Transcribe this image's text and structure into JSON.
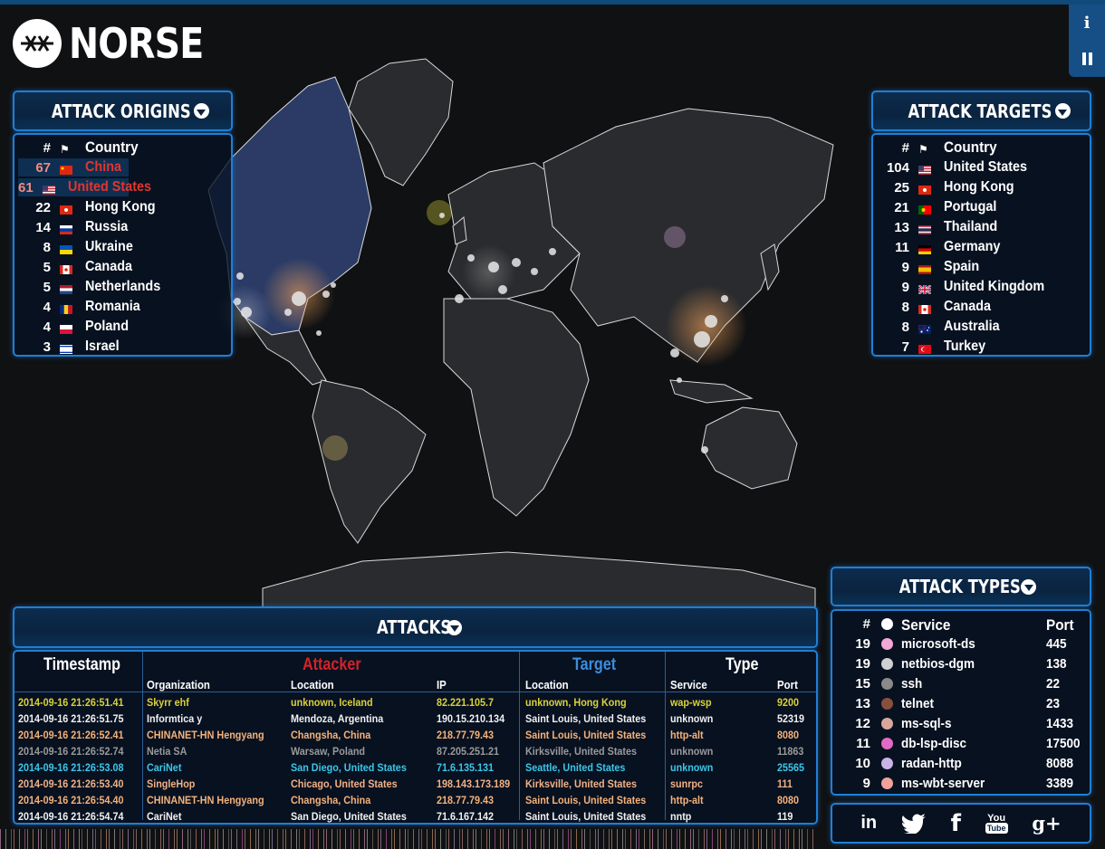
{
  "brand": {
    "name": "NORSE"
  },
  "controls": {
    "info_label": "i",
    "pause_label": "II"
  },
  "origins": {
    "title": "ATTACK ORIGINS",
    "headers": {
      "num": "#",
      "flag": "⚑",
      "country": "Country"
    },
    "rows": [
      {
        "count": "67",
        "country": "China",
        "flag": "china",
        "highlight": true
      },
      {
        "count": "61",
        "country": "United States",
        "flag": "usa",
        "highlight": true
      },
      {
        "count": "22",
        "country": "Hong Kong",
        "flag": "hongkong"
      },
      {
        "count": "14",
        "country": "Russia",
        "flag": "russia"
      },
      {
        "count": "8",
        "country": "Ukraine",
        "flag": "ukraine"
      },
      {
        "count": "5",
        "country": "Canada",
        "flag": "canada"
      },
      {
        "count": "5",
        "country": "Netherlands",
        "flag": "netherlands"
      },
      {
        "count": "4",
        "country": "Romania",
        "flag": "romania"
      },
      {
        "count": "4",
        "country": "Poland",
        "flag": "poland"
      },
      {
        "count": "3",
        "country": "Israel",
        "flag": "israel"
      }
    ]
  },
  "targets": {
    "title": "ATTACK TARGETS",
    "headers": {
      "num": "#",
      "flag": "⚑",
      "country": "Country"
    },
    "rows": [
      {
        "count": "104",
        "country": "United States",
        "flag": "usa"
      },
      {
        "count": "25",
        "country": "Hong Kong",
        "flag": "hongkong"
      },
      {
        "count": "21",
        "country": "Portugal",
        "flag": "portugal"
      },
      {
        "count": "13",
        "country": "Thailand",
        "flag": "thailand"
      },
      {
        "count": "11",
        "country": "Germany",
        "flag": "germany"
      },
      {
        "count": "9",
        "country": "Spain",
        "flag": "spain"
      },
      {
        "count": "9",
        "country": "United Kingdom",
        "flag": "uk"
      },
      {
        "count": "8",
        "country": "Canada",
        "flag": "canada"
      },
      {
        "count": "8",
        "country": "Australia",
        "flag": "australia"
      },
      {
        "count": "7",
        "country": "Turkey",
        "flag": "turkey"
      }
    ]
  },
  "types": {
    "title": "ATTACK TYPES",
    "headers": {
      "num": "#",
      "service": "Service",
      "port": "Port"
    },
    "rows": [
      {
        "count": "19",
        "service": "microsoft-ds",
        "port": "445",
        "color": "#f2a8d6"
      },
      {
        "count": "19",
        "service": "netbios-dgm",
        "port": "138",
        "color": "#d0d0d0"
      },
      {
        "count": "15",
        "service": "ssh",
        "port": "22",
        "color": "#8a8a8a"
      },
      {
        "count": "13",
        "service": "telnet",
        "port": "23",
        "color": "#8a4f3c"
      },
      {
        "count": "12",
        "service": "ms-sql-s",
        "port": "1433",
        "color": "#d8a89a"
      },
      {
        "count": "11",
        "service": "db-lsp-disc",
        "port": "17500",
        "color": "#e06bc4"
      },
      {
        "count": "10",
        "service": "radan-http",
        "port": "8088",
        "color": "#c9b3e6"
      },
      {
        "count": "9",
        "service": "ms-wbt-server",
        "port": "3389",
        "color": "#f0a39b"
      }
    ]
  },
  "attacks": {
    "title": "ATTACKS",
    "headers": {
      "timestamp": "Timestamp",
      "attacker": "Attacker",
      "target": "Target",
      "type": "Type",
      "organization": "Organization",
      "location": "Location",
      "ip": "IP",
      "target_location": "Location",
      "service": "Service",
      "port": "Port"
    },
    "rows": [
      {
        "ts": "2014-09-16 21:26:51.41",
        "org": "Skyrr ehf",
        "loc": "unknown, Iceland",
        "ip": "82.221.105.7",
        "tloc": "unknown, Hong Kong",
        "svc": "wap-wsp",
        "port": "9200",
        "color": "#d9d23a"
      },
      {
        "ts": "2014-09-16 21:26:51.75",
        "org": "Informtica y",
        "loc": "Mendoza, Argentina",
        "ip": "190.15.210.134",
        "tloc": "Saint Louis, United States",
        "svc": "unknown",
        "port": "52319",
        "color": "#f1f1f1"
      },
      {
        "ts": "2014-09-16 21:26:52.41",
        "org": "CHINANET-HN Hengyang",
        "loc": "Changsha, China",
        "ip": "218.77.79.43",
        "tloc": "Saint Louis, United States",
        "svc": "http-alt",
        "port": "8080",
        "color": "#f5b27a"
      },
      {
        "ts": "2014-09-16 21:26:52.74",
        "org": "Netia SA",
        "loc": "Warsaw, Poland",
        "ip": "87.205.251.21",
        "tloc": "Kirksville, United States",
        "svc": "unknown",
        "port": "11863",
        "color": "#9a9a9a"
      },
      {
        "ts": "2014-09-16 21:26:53.08",
        "org": "CariNet",
        "loc": "San Diego, United States",
        "ip": "71.6.135.131",
        "tloc": "Seattle, United States",
        "svc": "unknown",
        "port": "25565",
        "color": "#3cc6e8"
      },
      {
        "ts": "2014-09-16 21:26:53.40",
        "org": "SingleHop",
        "loc": "Chicago, United States",
        "ip": "198.143.173.189",
        "tloc": "Kirksville, United States",
        "svc": "sunrpc",
        "port": "111",
        "color": "#f0b287"
      },
      {
        "ts": "2014-09-16 21:26:54.40",
        "org": "CHINANET-HN Hengyang",
        "loc": "Changsha, China",
        "ip": "218.77.79.43",
        "tloc": "Saint Louis, United States",
        "svc": "http-alt",
        "port": "8080",
        "color": "#f5b27a"
      },
      {
        "ts": "2014-09-16 21:26:54.74",
        "org": "CariNet",
        "loc": "San Diego, United States",
        "ip": "71.6.167.142",
        "tloc": "Saint Louis, United States",
        "svc": "nntp",
        "port": "119",
        "color": "#f1f1f1"
      }
    ]
  },
  "social": {
    "linkedin": "in",
    "twitter": "twitter-icon",
    "facebook": "f",
    "youtube_top": "You",
    "youtube_bottom": "Tube",
    "gplus": "g+"
  },
  "colors": {
    "attacker": "#d2232a",
    "target": "#3a8ee0",
    "panel_border": "#1f7fd6",
    "highlight_text": "#e0362f"
  }
}
